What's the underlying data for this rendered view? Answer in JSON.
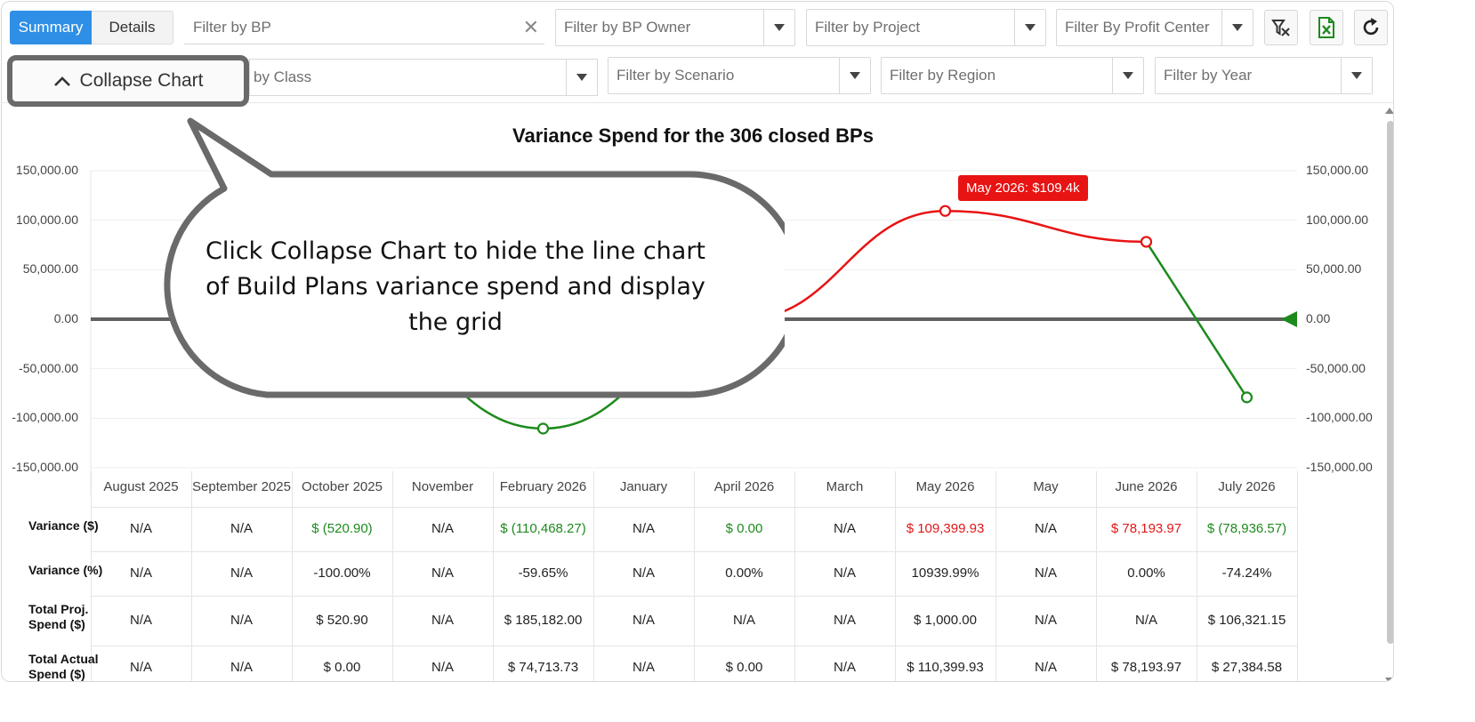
{
  "toolbar": {
    "summary_label": "Summary",
    "details_label": "Details",
    "bp_filter_placeholder": "Filter by BP",
    "clear_symbol": "✕",
    "filters_row1": [
      "Filter by BP Owner",
      "Filter by Project",
      "Filter By Profit Center"
    ],
    "filters_row2": [
      "by Class",
      "Filter by Scenario",
      "Filter by Region",
      "Filter by Year"
    ],
    "icons": [
      "clear-filters-icon",
      "excel-export-icon",
      "refresh-icon"
    ],
    "collapse_label": "Collapse Chart"
  },
  "callout": {
    "text": "Click Collapse Chart to hide the line chart of Build Plans variance spend and display the grid"
  },
  "chart_data": {
    "type": "line",
    "title": "Variance Spend for the 306 closed BPs",
    "categories": [
      "August 2025",
      "September 2025",
      "October 2025",
      "November",
      "February 2026",
      "January",
      "April 2026",
      "March",
      "May 2026",
      "May",
      "June 2026",
      "July 2026"
    ],
    "values": [
      null,
      null,
      -520.9,
      null,
      -110468.27,
      null,
      0.0,
      null,
      109399.93,
      null,
      78193.97,
      -78936.57
    ],
    "ylim": [
      -150000,
      150000
    ],
    "yticks": [
      "150,000.00",
      "100,000.00",
      "50,000.00",
      "0.00",
      "-50,000.00",
      "-100,000.00",
      "-150,000.00"
    ],
    "positive_color": "#e81313",
    "negative_color": "#1d8a1d",
    "tooltip": "May 2026: $109.4k",
    "grid": true
  },
  "grid": {
    "rows": [
      {
        "label": "Variance ($)",
        "cells": [
          "N/A",
          "N/A",
          "$ (520.90)",
          "N/A",
          "$ (110,468.27)",
          "N/A",
          "$ 0.00",
          "N/A",
          "$ 109,399.93",
          "N/A",
          "$ 78,193.97",
          "$ (78,936.57)"
        ],
        "colors": [
          "",
          "",
          "g",
          "",
          "g",
          "",
          "g",
          "",
          "r",
          "",
          "r",
          "g"
        ]
      },
      {
        "label": "Variance (%)",
        "cells": [
          "N/A",
          "N/A",
          "-100.00%",
          "N/A",
          "-59.65%",
          "N/A",
          "0.00%",
          "N/A",
          "10939.99%",
          "N/A",
          "0.00%",
          "-74.24%"
        ],
        "colors": [
          "",
          "",
          "",
          "",
          "",
          "",
          "",
          "",
          "",
          "",
          "",
          ""
        ]
      },
      {
        "label": "Total Proj. Spend ($)",
        "cells": [
          "N/A",
          "N/A",
          "$ 520.90",
          "N/A",
          "$ 185,182.00",
          "N/A",
          "N/A",
          "N/A",
          "$ 1,000.00",
          "N/A",
          "N/A",
          "$ 106,321.15"
        ],
        "colors": [
          "",
          "",
          "",
          "",
          "",
          "",
          "",
          "",
          "",
          "",
          "",
          ""
        ]
      },
      {
        "label": "Total Actual Spend ($)",
        "cells": [
          "N/A",
          "N/A",
          "$ 0.00",
          "N/A",
          "$ 74,713.73",
          "N/A",
          "$ 0.00",
          "N/A",
          "$ 110,399.93",
          "N/A",
          "$ 78,193.97",
          "$ 27,384.58"
        ],
        "colors": [
          "",
          "",
          "",
          "",
          "",
          "",
          "",
          "",
          "",
          "",
          "",
          ""
        ]
      }
    ]
  }
}
